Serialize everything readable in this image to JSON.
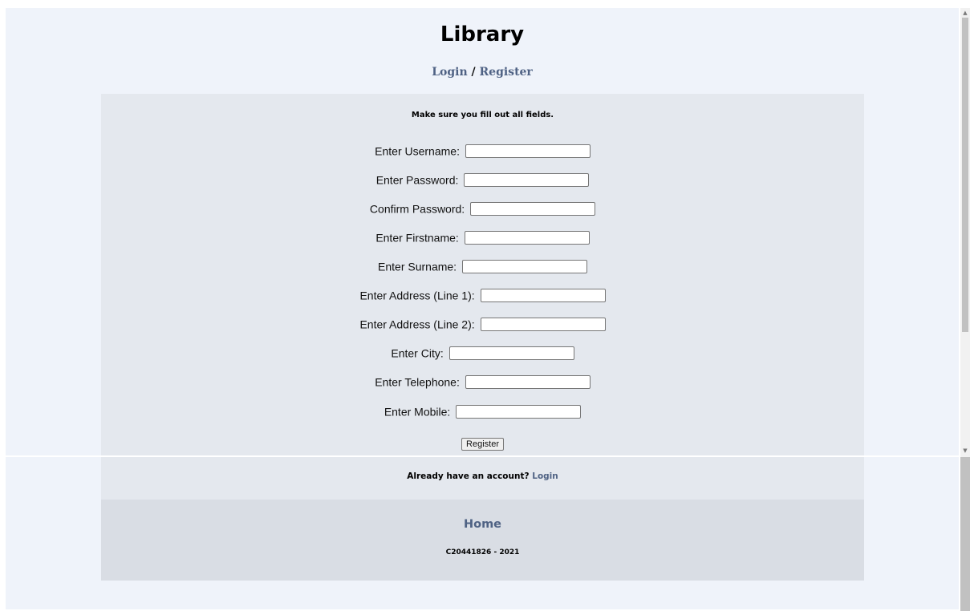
{
  "site": {
    "title": "Library"
  },
  "nav": {
    "login": "Login",
    "separator": "/",
    "register": "Register"
  },
  "form": {
    "notice": "Make sure you fill out all fields.",
    "fields": [
      {
        "label": "Enter Username:",
        "value": ""
      },
      {
        "label": "Enter Password:",
        "value": ""
      },
      {
        "label": "Confirm Password:",
        "value": ""
      },
      {
        "label": "Enter Firstname:",
        "value": ""
      },
      {
        "label": "Enter Surname:",
        "value": ""
      },
      {
        "label": "Enter Address (Line 1):",
        "value": ""
      },
      {
        "label": "Enter Address (Line 2):",
        "value": ""
      },
      {
        "label": "Enter City:",
        "value": ""
      },
      {
        "label": "Enter Telephone:",
        "value": ""
      },
      {
        "label": "Enter Mobile:",
        "value": ""
      }
    ],
    "submit_label": "Register"
  },
  "account": {
    "prompt": "Already have an account?",
    "login_link": "Login"
  },
  "footer": {
    "home_link": "Home",
    "copyright": "C20441826 - 2021"
  },
  "colors": {
    "page_bg": "#eff3fa",
    "panel_bg": "#e4e8ee",
    "footer_bg": "#d9dde4",
    "link": "#4f6284"
  },
  "icons": {
    "scroll_up": "scroll-up-arrow-icon",
    "scroll_down": "scroll-down-arrow-icon"
  }
}
